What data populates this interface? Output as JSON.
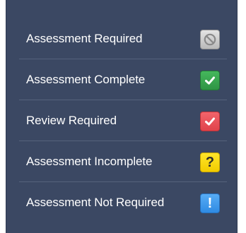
{
  "legend": {
    "items": [
      {
        "label": "Assessment Required",
        "icon": "not-allowed-icon",
        "color": "#c9c9c9"
      },
      {
        "label": "Assessment Complete",
        "icon": "checkmark-icon",
        "color": "#38a84f"
      },
      {
        "label": "Review Required",
        "icon": "checkmark-icon",
        "color": "#e8525a"
      },
      {
        "label": "Assessment Incomplete",
        "icon": "question-mark-icon",
        "glyph": "?",
        "color": "#ffd910"
      },
      {
        "label": "Assessment Not Required",
        "icon": "exclamation-mark-icon",
        "glyph": "!",
        "color": "#3d97ea"
      }
    ],
    "background": "#3b4863"
  }
}
